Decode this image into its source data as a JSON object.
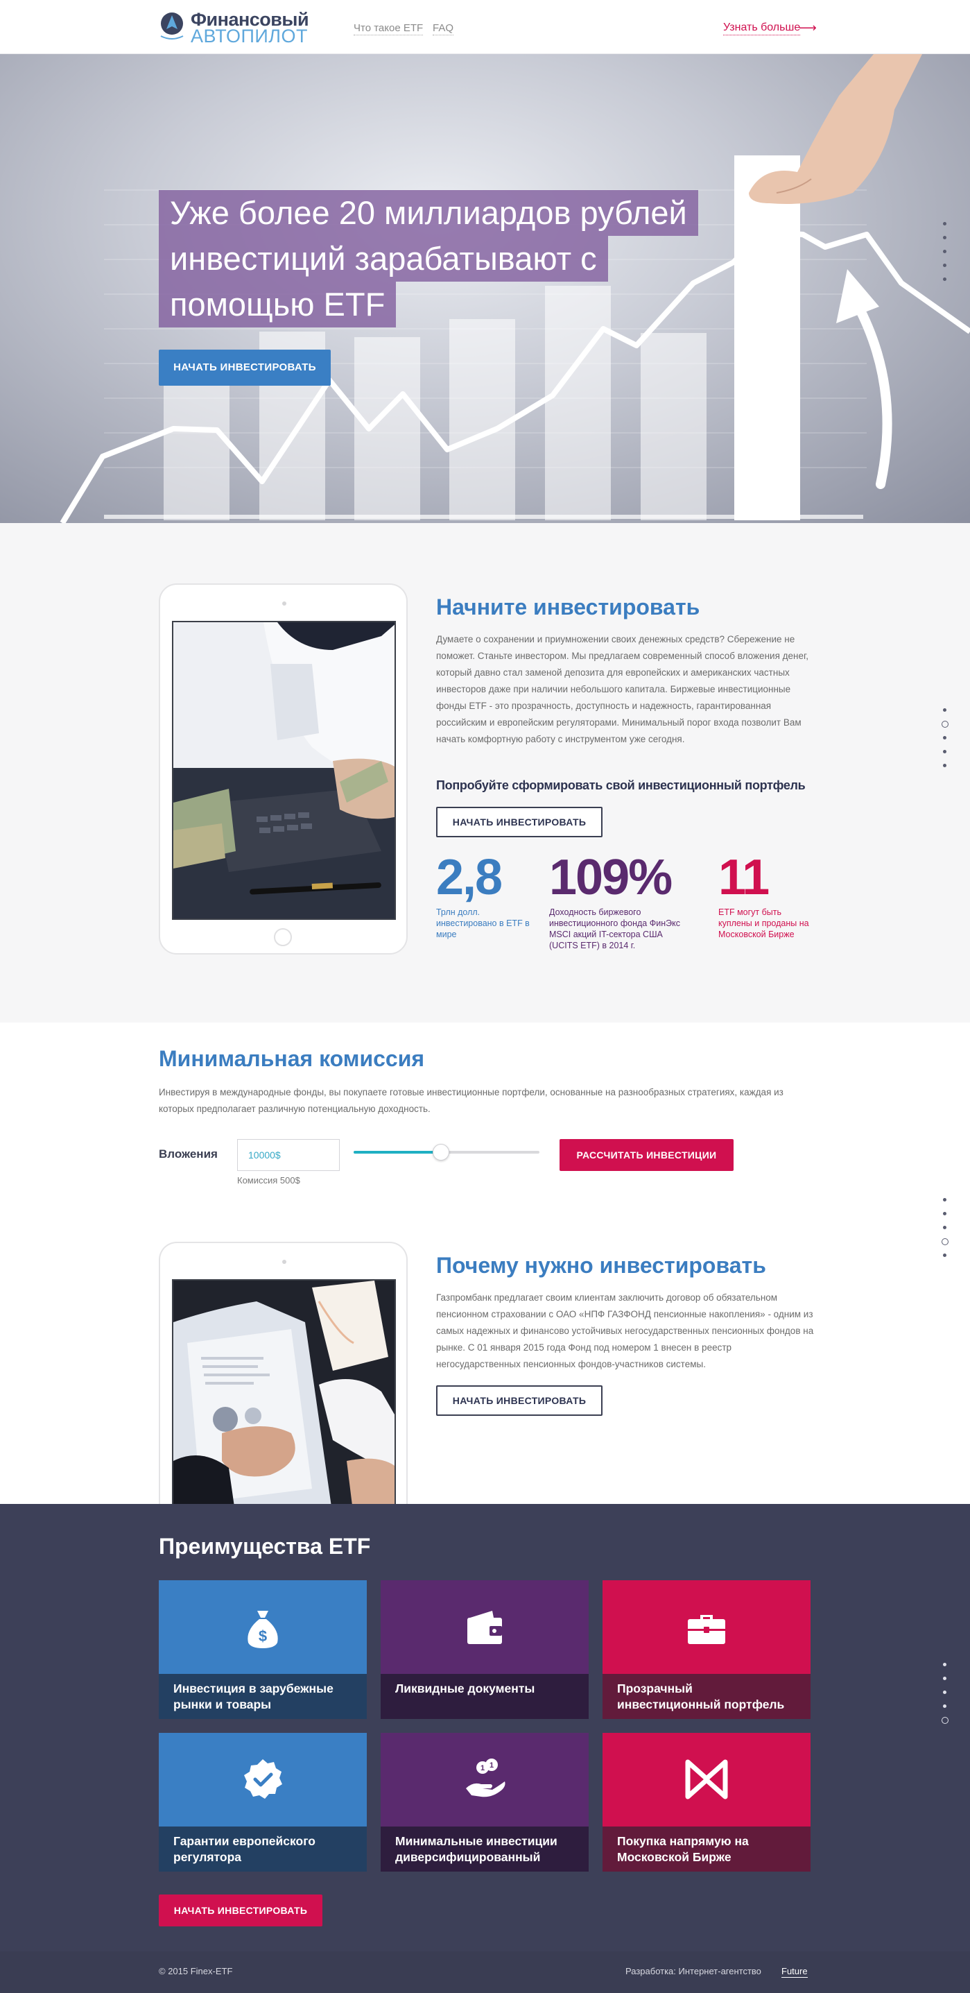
{
  "header": {
    "logo_line1": "Финансовый",
    "logo_line2": "АВТОПИЛОТ",
    "nav": [
      {
        "label": "Что такое ETF"
      },
      {
        "label": "FAQ"
      }
    ],
    "learn_more": "Узнать больше",
    "learn_more_icon": "arrow-right-icon"
  },
  "hero": {
    "lines": [
      "Уже более 20 миллиардов рублей",
      "инвестиций зарабатывают с",
      "помощью ETF"
    ],
    "cta": "НАЧАТЬ ИНВЕСТИРОВАТЬ"
  },
  "start": {
    "title": "Начните инвестировать",
    "text": "Думаете о сохранении и приумножении своих денежных средств? Сбережение не поможет. Станьте инвестором. Мы предлагаем современный способ вложения денег, который давно стал заменой депозита для европейских и американских частных инвесторов даже при наличии небольшого капитала. Биржевые инвестиционные фонды ETF - это прозрачность, доступность и надежность, гарантированная российским и европейским регуляторами. Минимальный порог входа позволит Вам начать комфортную работу с инструментом уже сегодня.",
    "subtitle": "Попробуйте сформировать свой инвестиционный портфель",
    "cta": "НАЧАТЬ ИНВЕСТИРОВАТЬ",
    "stats": [
      {
        "value": "2,8",
        "caption": "Трлн долл. инвестировано в ETF в мире",
        "color": "#3b7dc0"
      },
      {
        "value": "109%",
        "caption": "Доходность биржевого инвестиционного фонда ФинЭкс MSCI акций IT-сектора США (UCITS ETF) в 2014 г.",
        "color": "#5a2a6e"
      },
      {
        "value": "11",
        "caption": "ETF могут быть куплены и проданы на Московской Бирже",
        "color": "#d0104f"
      }
    ]
  },
  "commission": {
    "title": "Минимальная комиссия",
    "text": "Инвестируя в международные фонды, вы покупаете готовые инвестиционные портфели, основанные на разнообразных стратегиях, каждая из которых предполагает различную потенциальную доходность.",
    "label": "Вложения",
    "input_value": "10000$",
    "commission_text": "Комиссия 500$",
    "slider_fraction": 0.47,
    "cta": "РАССЧИТАТЬ ИНВЕСТИЦИИ"
  },
  "why": {
    "title": "Почему нужно инвестировать",
    "text": "Газпромбанк предлагает своим клиентам заключить договор об обязательном пенсионном страховании с ОАО «НПФ ГАЗФОНД пенсионные накопления» - одним из самых надежных и финансово устойчивых негосударственных пенсионных фондов на рынке. С 01 января 2015 года Фонд под номером 1 внесен в реестр негосударственных пенсионных фондов-участников системы.",
    "cta": "НАЧАТЬ ИНВЕСТИРОВАТЬ"
  },
  "advantages": {
    "title": "Преимущества ETF",
    "cards": [
      {
        "label": "Инвестиция в зарубежные рынки и товары",
        "icon": "money-bag-icon",
        "color": "#3a7fc4",
        "dark": "#234062"
      },
      {
        "label": "Ликвидные документы",
        "icon": "wallet-icon",
        "color": "#5a2a6e",
        "dark": "#2e1d3e"
      },
      {
        "label": "Прозрачный инвестиционный портфель",
        "icon": "briefcase-icon",
        "color": "#d0104f",
        "dark": "#621b3b"
      },
      {
        "label": "Гарантии европейского регулятора",
        "icon": "verified-badge-icon",
        "color": "#3a7fc4",
        "dark": "#234062"
      },
      {
        "label": "Минимальные инвестиции диверсифицированный",
        "icon": "hand-coins-icon",
        "color": "#5a2a6e",
        "dark": "#2e1d3e"
      },
      {
        "label": "Покупка напрямую на Московской Бирже",
        "icon": "moex-logo-icon",
        "color": "#d0104f",
        "dark": "#621b3b"
      }
    ],
    "cta": "НАЧАТЬ ИНВЕСТИРОВАТЬ"
  },
  "footer": {
    "copyright": "© 2015 Finex-ETF",
    "developer": "Разработка: Интернет-агентство",
    "developer_link": "Future"
  }
}
